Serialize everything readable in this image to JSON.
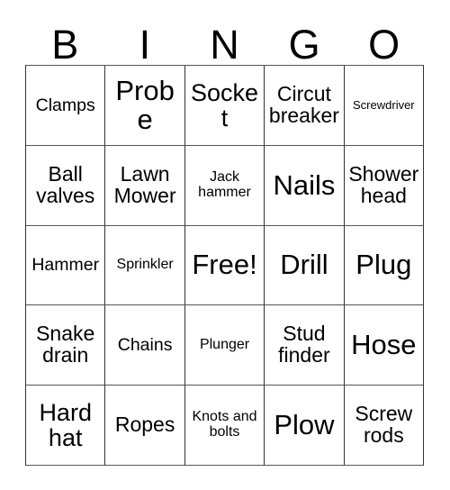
{
  "card": {
    "title": "BINGO",
    "header_letters": [
      "B",
      "I",
      "N",
      "G",
      "O"
    ],
    "free_space": {
      "row": 2,
      "col": 2,
      "label": "Free!"
    },
    "rows": [
      [
        {
          "label": "Clamps",
          "size": "sm"
        },
        {
          "label": "Probe",
          "size": "xl"
        },
        {
          "label": "Socket",
          "size": "lg"
        },
        {
          "label": "Circut breaker",
          "size": "md"
        },
        {
          "label": "Screwdriver",
          "size": "xxs"
        }
      ],
      [
        {
          "label": "Ball valves",
          "size": "md"
        },
        {
          "label": "Lawn Mower",
          "size": "md"
        },
        {
          "label": "Jack hammer",
          "size": "xs"
        },
        {
          "label": "Nails",
          "size": "xl"
        },
        {
          "label": "Shower head",
          "size": "md"
        }
      ],
      [
        {
          "label": "Hammer",
          "size": "sm"
        },
        {
          "label": "Sprinkler",
          "size": "xs"
        },
        {
          "label": "Free!",
          "size": "xl"
        },
        {
          "label": "Drill",
          "size": "xl"
        },
        {
          "label": "Plug",
          "size": "xl"
        }
      ],
      [
        {
          "label": "Snake drain",
          "size": "md"
        },
        {
          "label": "Chains",
          "size": "sm"
        },
        {
          "label": "Plunger",
          "size": "xs"
        },
        {
          "label": "Stud finder",
          "size": "md"
        },
        {
          "label": "Hose",
          "size": "xl"
        }
      ],
      [
        {
          "label": "Hard hat",
          "size": "lg"
        },
        {
          "label": "Ropes",
          "size": "md"
        },
        {
          "label": "Knots and bolts",
          "size": "xs"
        },
        {
          "label": "Plow",
          "size": "xl"
        },
        {
          "label": "Screw rods",
          "size": "md"
        }
      ]
    ]
  },
  "colors": {
    "background": "#ffffff",
    "text": "#000000",
    "border": "#333333"
  }
}
